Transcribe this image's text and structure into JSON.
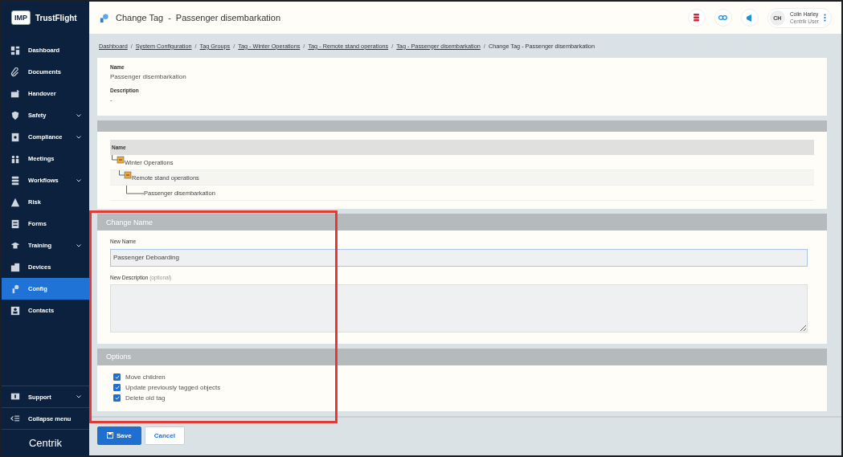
{
  "brand": {
    "badge": "IMP",
    "name": "TrustFlight",
    "footer_logo": "Centrik"
  },
  "sidebar": {
    "items": [
      {
        "label": "Dashboard",
        "expandable": false,
        "selected": false
      },
      {
        "label": "Documents",
        "expandable": false,
        "selected": false
      },
      {
        "label": "Handover",
        "expandable": false,
        "selected": false
      },
      {
        "label": "Safety",
        "expandable": true,
        "selected": false
      },
      {
        "label": "Compliance",
        "expandable": true,
        "selected": false
      },
      {
        "label": "Meetings",
        "expandable": false,
        "selected": false
      },
      {
        "label": "Workflows",
        "expandable": true,
        "selected": false
      },
      {
        "label": "Risk",
        "expandable": false,
        "selected": false
      },
      {
        "label": "Forms",
        "expandable": false,
        "selected": false
      },
      {
        "label": "Training",
        "expandable": true,
        "selected": false
      },
      {
        "label": "Devices",
        "expandable": false,
        "selected": false
      },
      {
        "label": "Config",
        "expandable": false,
        "selected": true
      },
      {
        "label": "Contacts",
        "expandable": false,
        "selected": false
      }
    ],
    "bottom": [
      {
        "label": "Support",
        "expandable": true
      },
      {
        "label": "Collapse menu",
        "expandable": false
      }
    ]
  },
  "header": {
    "title": "Change Tag",
    "separator": "-",
    "subtitle": "Passenger disembarkation",
    "user": {
      "initials": "CH",
      "name": "Colin Harley",
      "role": "Centrik User"
    }
  },
  "breadcrumb_separator": "/",
  "breadcrumbs": [
    {
      "label": "Dashboard",
      "link": true
    },
    {
      "label": "System Configuration",
      "link": true
    },
    {
      "label": "Tag Groups",
      "link": true
    },
    {
      "label": "Tag - Winter Operations",
      "link": true
    },
    {
      "label": "Tag - Remote stand operations",
      "link": true
    },
    {
      "label": "Tag - Passenger disembarkation",
      "link": true
    },
    {
      "label": "Change Tag - Passenger disembarkation",
      "link": false
    }
  ],
  "details": [
    {
      "label": "Name",
      "value": "Passenger disembarkation"
    },
    {
      "label": "Description",
      "value": "-"
    }
  ],
  "tree": {
    "column": "Name",
    "nodes": [
      {
        "label": "Winter Operations",
        "children": [
          {
            "label": "Remote stand operations",
            "children": [
              {
                "label": "Passenger disembarkation"
              }
            ]
          }
        ]
      }
    ]
  },
  "change_name": {
    "title": "Change Name",
    "name_label": "New Name",
    "name_value": "Passenger Deboarding",
    "description_label": "New Description",
    "description_hint": "(optional)"
  },
  "options": {
    "title": "Options",
    "items": [
      {
        "label": "Move children",
        "checked": true
      },
      {
        "label": "Update previously tagged objects",
        "checked": true
      },
      {
        "label": "Delete old tag",
        "checked": true
      }
    ]
  },
  "buttons": [
    {
      "label": "Save",
      "kind": "primary"
    },
    {
      "label": "Cancel",
      "kind": "secondary"
    }
  ]
}
